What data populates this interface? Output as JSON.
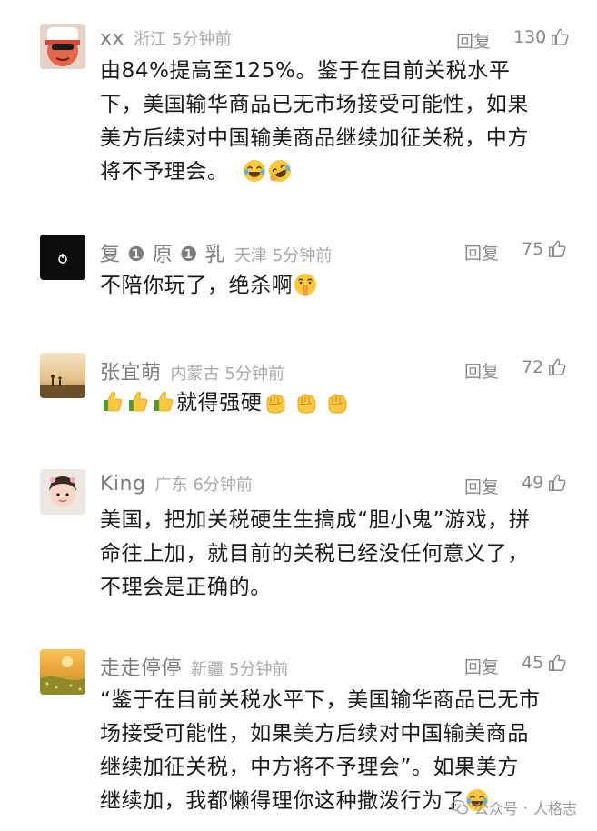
{
  "comments": [
    {
      "name": "xx",
      "region": "浙江",
      "time": "5分钟前",
      "reply_label": "回复",
      "likes": "130",
      "lines": [
        "由84%提高至125%。鉴于在目前关税水平",
        "下，美国输华商品已无市场接受可能性，如果",
        "美方后续对中国输美商品继续加征关税，中方",
        "将不予理会。"
      ],
      "emojis": [
        "laughing-tears-emoji",
        "rolling-laughing-emoji"
      ]
    },
    {
      "name": "复 ❶ 原 ❶ 乳",
      "region": "天津",
      "time": "5分钟前",
      "reply_label": "回复",
      "likes": "75",
      "lines": [
        "不陪你玩了，绝杀啊"
      ],
      "emojis": [
        "shushing-face-emoji"
      ]
    },
    {
      "name": "张宜萌",
      "region": "内蒙古",
      "time": "5分钟前",
      "reply_label": "回复",
      "likes": "72",
      "lines": [
        "就得强硬"
      ],
      "emojis": [
        "thumbs-up-emoji",
        "fist-emoji"
      ]
    },
    {
      "name": "King",
      "region": "广东",
      "time": "6分钟前",
      "reply_label": "回复",
      "likes": "49",
      "lines": [
        "美国，把加关税硬生生搞成“胆小鬼”游戏，拼",
        "命往上加，就目前的关税已经没任何意义了，",
        "不理会是正确的。"
      ]
    },
    {
      "name": "走走停停",
      "region": "新疆",
      "time": "5分钟前",
      "reply_label": "回复",
      "likes": "45",
      "lines": [
        "“鉴于在目前关税水平下，美国输华商品已无市",
        "场接受可能性，如果美方后续对中国输美商品",
        "继续加征关税，中方将不予理会”。如果美方",
        "继续加，我都懒得理你这种撒泼行为了"
      ],
      "emojis": [
        "laughing-tears-emoji"
      ]
    }
  ],
  "watermark": {
    "source": "公众号",
    "separator": "·",
    "author": "人格志"
  },
  "colors": {
    "text": "#1a1a1a",
    "meta": "#a9a9a9",
    "name": "#7d7d7d",
    "emoji_yellow": "#ffc83d"
  }
}
